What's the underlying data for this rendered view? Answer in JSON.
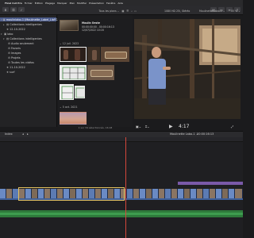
{
  "menubar": {
    "apple": "",
    "app_name": "Final Cut Pro",
    "items": [
      "Fichier",
      "Édition",
      "Élagage",
      "Marquer",
      "Plan",
      "Modifier",
      "Présentation",
      "Fenêtre",
      "Aide"
    ]
  },
  "browser": {
    "header_filter": "Tous les plans ⌄",
    "sections": [
      {
        "date": "⌄ 12 juil. 2022"
      },
      {
        "date": "⌄ 5 oct. 2021"
      },
      {
        "date": "⌄ 4 oct. 2021"
      }
    ],
    "clips": [
      {
        "title": "Moulin Oeste",
        "info": "Moulinette Labo-1"
      },
      {
        "title": "00:00:00:00 - 00:00:16:13",
        "info": "12/07/2022 10:16"
      }
    ],
    "footer": "1 sur 34 sélectionnés, 16:18"
  },
  "sidebar": {
    "items": [
      {
        "label": "moulinlabo-1 (Moulinette_Label_LibFC.fcpbundle)",
        "icon": "library-icon",
        "expanded": true,
        "selected": true
      },
      {
        "label": "Collections intelligentes",
        "icon": "folder-icon",
        "expanded": false,
        "selected": false
      },
      {
        "label": "12-10-2022",
        "icon": "event-icon",
        "expanded": false,
        "selected": false
      },
      {
        "label": "labo",
        "icon": "library-icon",
        "expanded": true,
        "selected": false
      },
      {
        "label": "Collections intelligentes",
        "icon": "folder-icon",
        "expanded": true,
        "selected": false
      },
      {
        "label": "Audio seulement",
        "icon": "smart-icon",
        "expanded": false,
        "selected": false
      },
      {
        "label": "Favoris",
        "icon": "smart-icon",
        "expanded": false,
        "selected": false
      },
      {
        "label": "Images",
        "icon": "smart-icon",
        "expanded": false,
        "selected": false
      },
      {
        "label": "Projets",
        "icon": "smart-icon",
        "expanded": false,
        "selected": false
      },
      {
        "label": "Toutes les vidéos",
        "icon": "smart-icon",
        "expanded": false,
        "selected": false
      },
      {
        "label": "11-10-2022",
        "icon": "event-icon",
        "expanded": false,
        "selected": false
      },
      {
        "label": "surf",
        "icon": "event-icon",
        "expanded": false,
        "selected": false
      }
    ]
  },
  "viewer": {
    "format": "1080 HD 25i, Stéréo",
    "project": "Moulinette Labo-1 ⌄",
    "zoom": "55 % ⌄",
    "timecode": "4:17"
  },
  "timeline": {
    "index_label": "Index",
    "project_name": "Moulinette Labo-1 ⌄",
    "duration": "00:00:16:13"
  },
  "colors": {
    "accent": "#4b5b8b",
    "playhead": "#d4473b",
    "clip_blue": "#3e5f9a",
    "audio_green": "#2e7a3b"
  }
}
